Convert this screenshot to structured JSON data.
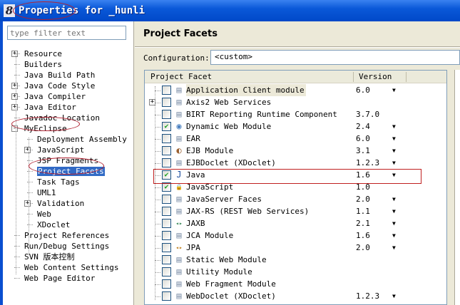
{
  "window": {
    "title": "Properties for _hunli",
    "icon": "eclipse-8-icon"
  },
  "filter": {
    "placeholder": "type filter text"
  },
  "tree": [
    {
      "label": "Resource",
      "level": 0,
      "expand": "+"
    },
    {
      "label": "Builders",
      "level": 0
    },
    {
      "label": "Java Build Path",
      "level": 0
    },
    {
      "label": "Java Code Style",
      "level": 0,
      "expand": "+"
    },
    {
      "label": "Java Compiler",
      "level": 0,
      "expand": "+"
    },
    {
      "label": "Java Editor",
      "level": 0,
      "expand": "+"
    },
    {
      "label": "Javadoc Location",
      "level": 0
    },
    {
      "label": "MyEclipse",
      "level": 0,
      "expand": "-"
    },
    {
      "label": "Deployment Assembly",
      "level": 1
    },
    {
      "label": "JavaScript",
      "level": 1,
      "expand": "+"
    },
    {
      "label": "JSP Fragments",
      "level": 1
    },
    {
      "label": "Project Facets",
      "level": 1,
      "selected": true
    },
    {
      "label": "Task Tags",
      "level": 1
    },
    {
      "label": "UML1",
      "level": 1
    },
    {
      "label": "Validation",
      "level": 1,
      "expand": "+"
    },
    {
      "label": "Web",
      "level": 1
    },
    {
      "label": "XDoclet",
      "level": 1
    },
    {
      "label": "Project References",
      "level": 0
    },
    {
      "label": "Run/Debug Settings",
      "level": 0
    },
    {
      "label": "SVN 版本控制",
      "level": 0
    },
    {
      "label": "Web Content Settings",
      "level": 0
    },
    {
      "label": "Web Page Editor",
      "level": 0
    }
  ],
  "page": {
    "title": "Project Facets",
    "config_label": "Configuration:",
    "config_value": "<custom>"
  },
  "table": {
    "headers": [
      "Project Facet",
      "Version"
    ],
    "rows": [
      {
        "name": "Application Client module",
        "version": "6.0",
        "checked": false,
        "dropdown": true,
        "icon": "doc"
      },
      {
        "name": "Axis2 Web Services",
        "version": "",
        "checked": false,
        "dropdown": false,
        "icon": "doc",
        "expand": "+"
      },
      {
        "name": "BIRT Reporting Runtime Component",
        "version": "3.7.0",
        "checked": false,
        "dropdown": false,
        "icon": "doc"
      },
      {
        "name": "Dynamic Web Module",
        "version": "2.4",
        "checked": true,
        "dropdown": true,
        "icon": "web"
      },
      {
        "name": "EAR",
        "version": "6.0",
        "checked": false,
        "dropdown": true,
        "icon": "doc"
      },
      {
        "name": "EJB Module",
        "version": "3.1",
        "checked": false,
        "dropdown": true,
        "icon": "bean"
      },
      {
        "name": "EJBDoclet (XDoclet)",
        "version": "1.2.3",
        "checked": false,
        "dropdown": true,
        "icon": "doc"
      },
      {
        "name": "Java",
        "version": "1.6",
        "checked": true,
        "dropdown": true,
        "icon": "java"
      },
      {
        "name": "JavaScript",
        "version": "1.0",
        "checked": true,
        "dropdown": false,
        "icon": "lock"
      },
      {
        "name": "JavaServer Faces",
        "version": "2.0",
        "checked": false,
        "dropdown": true,
        "icon": "doc"
      },
      {
        "name": "JAX-RS (REST Web Services)",
        "version": "1.1",
        "checked": false,
        "dropdown": true,
        "icon": "doc"
      },
      {
        "name": "JAXB",
        "version": "2.1",
        "checked": false,
        "dropdown": true,
        "icon": "arrows"
      },
      {
        "name": "JCA Module",
        "version": "1.6",
        "checked": false,
        "dropdown": true,
        "icon": "doc"
      },
      {
        "name": "JPA",
        "version": "2.0",
        "checked": false,
        "dropdown": true,
        "icon": "arrows2"
      },
      {
        "name": "Static Web Module",
        "version": "",
        "checked": false,
        "dropdown": false,
        "icon": "doc"
      },
      {
        "name": "Utility Module",
        "version": "",
        "checked": false,
        "dropdown": false,
        "icon": "doc"
      },
      {
        "name": "Web Fragment Module",
        "version": "",
        "checked": false,
        "dropdown": false,
        "icon": "doc"
      },
      {
        "name": "WebDoclet (XDoclet)",
        "version": "1.2.3",
        "checked": false,
        "dropdown": true,
        "icon": "doc"
      }
    ]
  }
}
